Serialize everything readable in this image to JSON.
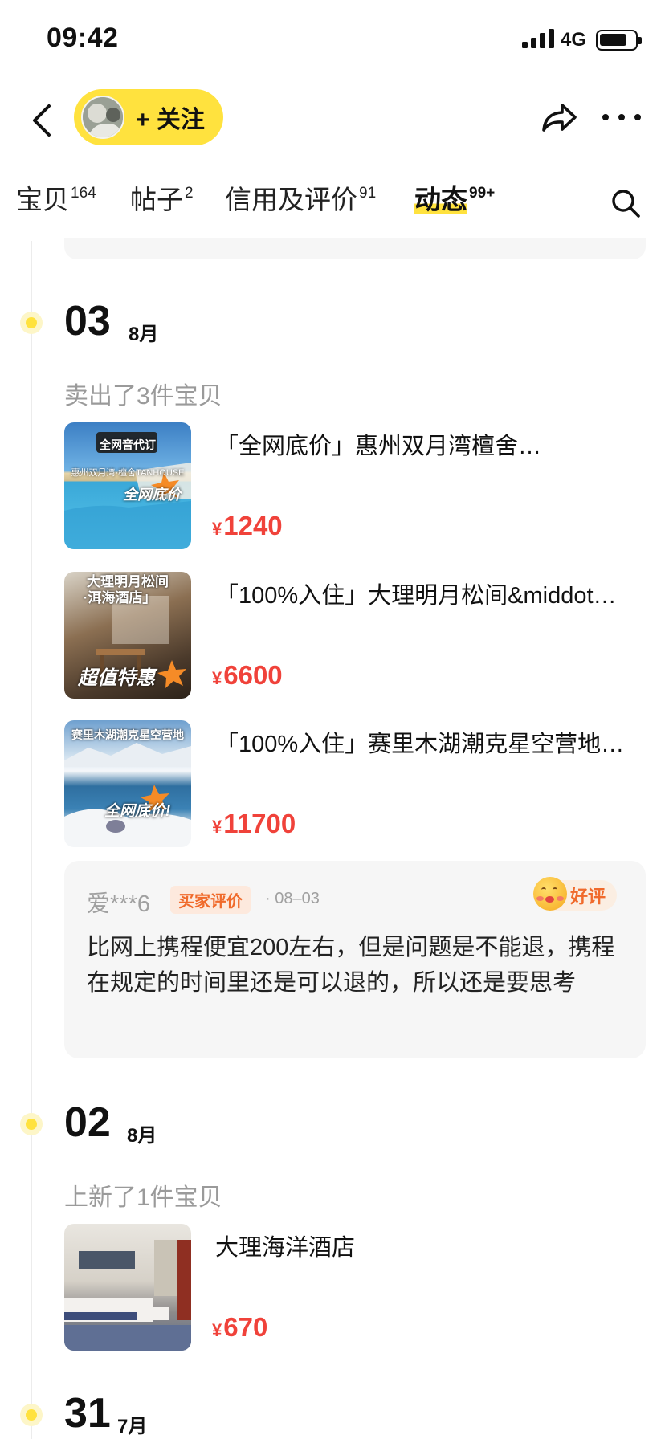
{
  "status_bar": {
    "time": "09:42",
    "network": "4G",
    "battery_level": 0.8
  },
  "nav": {
    "follow_label": "+ 关注"
  },
  "tabs": [
    {
      "label": "宝贝",
      "count": "164"
    },
    {
      "label": "帖子",
      "count": "2"
    },
    {
      "label": "信用及评价",
      "count": "91"
    },
    {
      "label": "动态",
      "count": "99+",
      "active": true
    }
  ],
  "feed": [
    {
      "day": "03",
      "month": "8月",
      "caption": "卖出了3件宝贝",
      "products": [
        {
          "title": "「全网底价」惠州双月湾檀舍…",
          "currency": "¥",
          "price": "1240",
          "thumb_text": [
            "全网音代订",
            "惠州双月湾·檀舍TANHOUSE",
            "全网底价"
          ]
        },
        {
          "title": "「100%入住」大理明月松间&middot…",
          "currency": "¥",
          "price": "6600",
          "thumb_text": [
            "大理明月松间",
            "·洱海酒店」",
            "超值特惠"
          ]
        },
        {
          "title": "「100%入住」赛里木湖潮克星空营地…",
          "currency": "¥",
          "price": "11700",
          "thumb_text": [
            "赛里木湖潮克星空营地",
            "全网底价!"
          ]
        }
      ],
      "review": {
        "user": "爱***6",
        "tag": "买家评价",
        "date": "· 08–03",
        "badge": "好评",
        "text": "比网上携程便宜200左右，但是问题是不能退，携程在规定的时间里还是可以退的，所以还是要思考"
      }
    },
    {
      "day": "02",
      "month": "8月",
      "caption": "上新了1件宝贝",
      "products": [
        {
          "title": "大理海洋酒店",
          "currency": "¥",
          "price": "670"
        }
      ]
    },
    {
      "day": "31",
      "month": "7月"
    }
  ],
  "colors": {
    "accent": "#ffe23e",
    "price": "#f0423a",
    "review_tag": "#f06a2b"
  },
  "icons": [
    "back-icon",
    "avatar",
    "share-icon",
    "more-icon",
    "search-icon",
    "smiley-icon"
  ]
}
